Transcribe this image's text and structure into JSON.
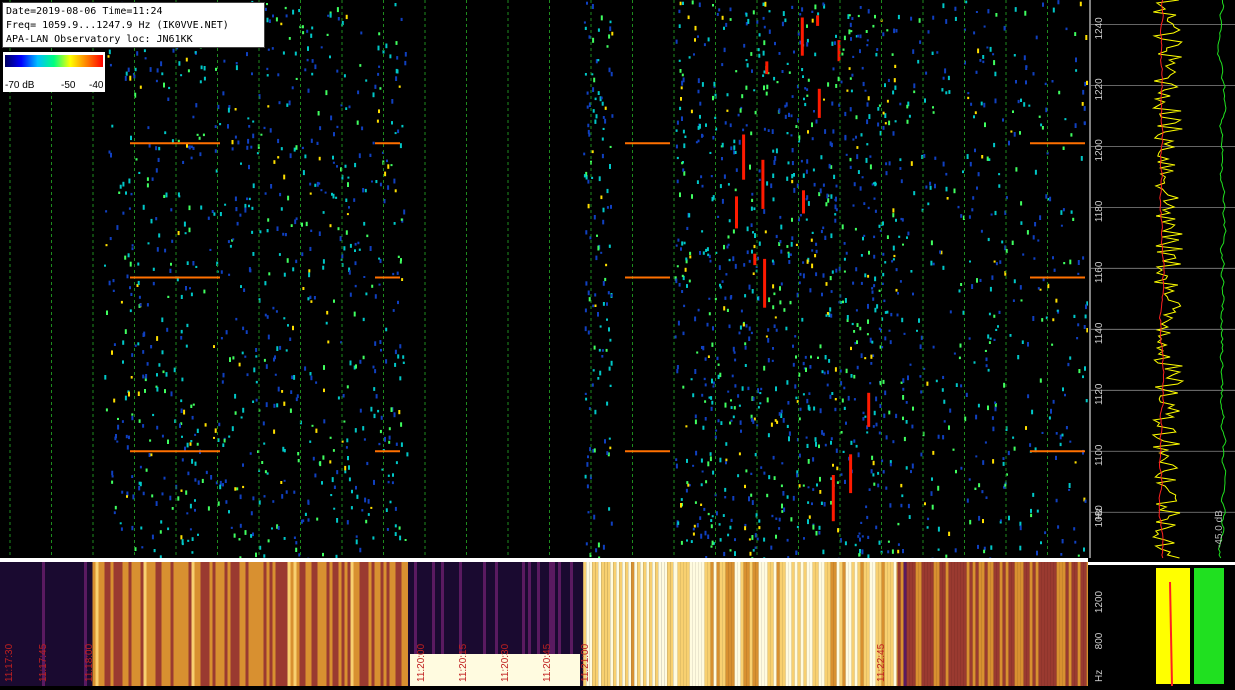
{
  "info": {
    "line1": "Date=2019-08-06 Time=11:24",
    "line2": "Freq= 1059.9...1247.9 Hz (IK0VVE.NET)",
    "line3": "APA-LAN Observatory loc: JN61KK"
  },
  "color_scale": {
    "labels": [
      "-70 dB",
      "-50",
      "-40"
    ],
    "colors": [
      "#000060",
      "#0000ff",
      "#00c0ff",
      "#00ff80",
      "#ffff00",
      "#ff8000",
      "#ff0000"
    ]
  },
  "chart_data": [
    {
      "type": "heatmap",
      "title": "",
      "ylabel": "Hz",
      "ylim": [
        1065,
        1248
      ],
      "yticks": [
        1080,
        1100,
        1120,
        1140,
        1160,
        1180,
        1200,
        1220,
        1240
      ],
      "segments": [
        {
          "start": 0.0,
          "end": 0.095,
          "intensity": 0.0
        },
        {
          "start": 0.095,
          "end": 0.375,
          "intensity": 0.45
        },
        {
          "start": 0.375,
          "end": 0.536,
          "intensity": 0.0
        },
        {
          "start": 0.536,
          "end": 0.562,
          "intensity": 0.75
        },
        {
          "start": 0.562,
          "end": 0.62,
          "intensity": 0.0
        },
        {
          "start": 0.62,
          "end": 0.825,
          "intensity": 0.7
        },
        {
          "start": 0.825,
          "end": 1.0,
          "intensity": 0.35
        }
      ],
      "carrier_lines_hz": [
        1100,
        1157,
        1201
      ],
      "side_plot_label": "-45.0 dB"
    },
    {
      "type": "heatmap",
      "title": "",
      "ylabel": "Hz",
      "yticks": [
        800,
        1200
      ],
      "x_tick_labels": [
        "11:17:30",
        "11:17:45",
        "11:18:00",
        "11:20:00",
        "11:20:15",
        "11:20:30",
        "11:20:45",
        "11:21:00",
        "11:22:45"
      ],
      "segments": [
        {
          "start": 0.0,
          "end": 0.085,
          "intensity": 0.0
        },
        {
          "start": 0.085,
          "end": 0.375,
          "intensity": 0.6
        },
        {
          "start": 0.375,
          "end": 0.536,
          "intensity": 0.05
        },
        {
          "start": 0.536,
          "end": 0.62,
          "intensity": 0.9
        },
        {
          "start": 0.62,
          "end": 0.825,
          "intensity": 0.85
        },
        {
          "start": 0.825,
          "end": 1.0,
          "intensity": 0.5
        }
      ]
    }
  ]
}
